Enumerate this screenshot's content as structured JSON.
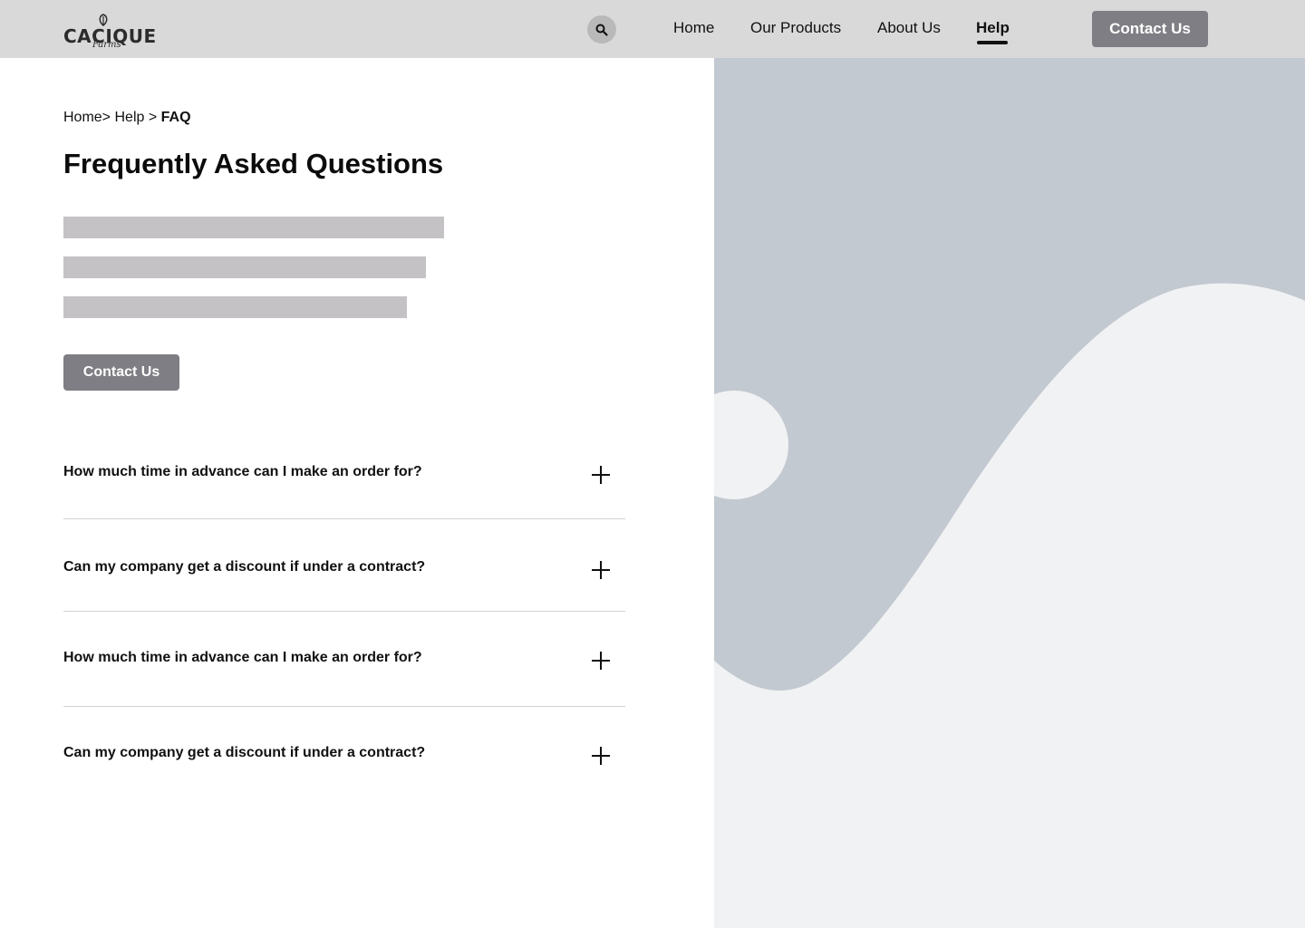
{
  "header": {
    "logo": {
      "word": "CACIQUE",
      "sub": "Farms"
    },
    "search_icon": "search-icon",
    "nav": [
      {
        "label": "Home",
        "active": false
      },
      {
        "label": "Our Products",
        "active": false
      },
      {
        "label": "About Us",
        "active": false
      },
      {
        "label": "Help",
        "active": true
      }
    ],
    "cta_label": "Contact Us"
  },
  "main": {
    "breadcrumb": {
      "home": "Home>",
      "help": "Help >",
      "current": "FAQ"
    },
    "title": "Frequently Asked Questions",
    "cta_label": "Contact Us",
    "faqs": [
      {
        "question": "How much time in advance can I make an order for?",
        "icon": "plus-icon"
      },
      {
        "question": "Can my company get a discount if under a contract?",
        "icon": "plus-icon"
      },
      {
        "question": "How much time in advance can I make an order for?",
        "icon": "plus-icon"
      },
      {
        "question": "Can my company get a discount if under a contract?",
        "icon": "plus-icon"
      }
    ]
  },
  "colors": {
    "header_bg": "#d9d9d9",
    "button_bg": "#7e7e84",
    "skeleton": "#c4c2c4",
    "illustration_bg": "#f1f2f4",
    "illustration_shape": "#c3c9d0"
  }
}
